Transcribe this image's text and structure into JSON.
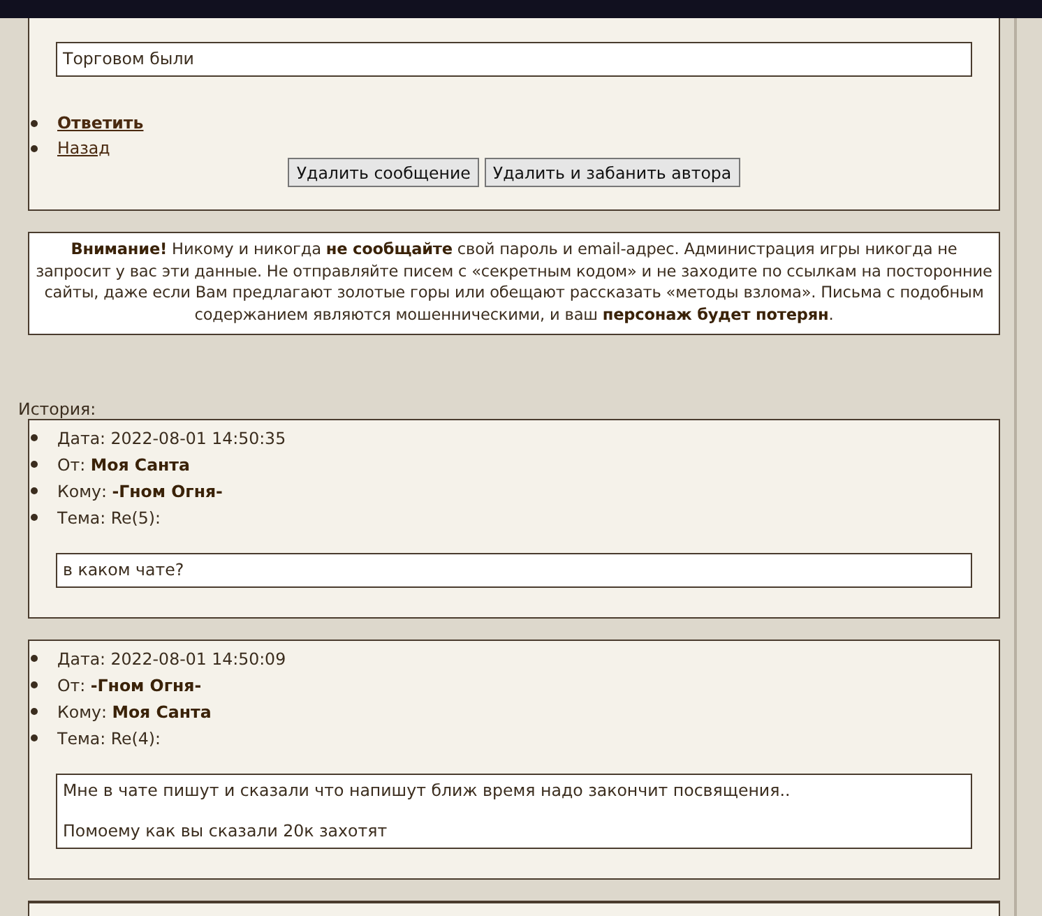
{
  "current_message": {
    "body": [
      "Торговом были"
    ]
  },
  "actions": [
    {
      "label": "Ответить",
      "bold": true
    },
    {
      "label": "Назад",
      "bold": false
    }
  ],
  "buttons": [
    "Удалить сообщение",
    "Удалить и забанить автора"
  ],
  "warning": [
    "**Внимание!** Никому и никогда **не сообщайте** свой пароль и email-адрес. Администрация игры никогда не запросит у вас эти данные. Не отправляйте писем с «секретным кодом» и не заходите по ссылкам на посторонние сайты, даже если Вам предлагают золотые горы или обещают рассказать «методы взлома». Письма с подобным содержанием являются мошенническими, и ваш **персонаж будет потерян**."
  ],
  "history": {
    "label": "История:",
    "messages": [
      {
        "fields": [
          {
            "label": "Дата:",
            "value": "2022-08-01 14:50:35",
            "bold": false
          },
          {
            "label": "От:",
            "value": "Моя Санта",
            "bold": true
          },
          {
            "label": "Кому:",
            "value": "-Гном Огня-",
            "bold": true
          },
          {
            "label": "Тема:",
            "value": "Re(5):",
            "bold": false
          }
        ],
        "body": [
          "в каком чате?"
        ]
      },
      {
        "fields": [
          {
            "label": "Дата:",
            "value": "2022-08-01 14:50:09",
            "bold": false
          },
          {
            "label": "От:",
            "value": "-Гном Огня-",
            "bold": true
          },
          {
            "label": "Кому:",
            "value": "Моя Санта",
            "bold": true
          },
          {
            "label": "Тема:",
            "value": "Re(4):",
            "bold": false
          }
        ],
        "body": [
          "Мне в чате пишут и сказали что напишут ближ время надо закончит посвящения..",
          "Помоему как вы сказали 20к захотят"
        ]
      }
    ]
  }
}
